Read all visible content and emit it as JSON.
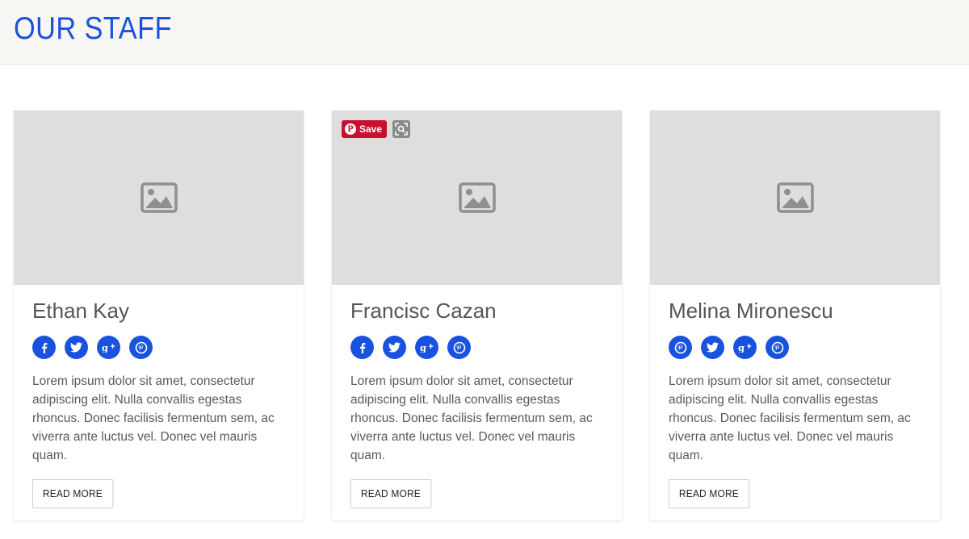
{
  "header": {
    "title": "OUR STAFF"
  },
  "pinterest": {
    "save_label": "Save"
  },
  "staff": [
    {
      "name": "Ethan Kay",
      "socials": [
        "facebook-icon",
        "twitter-icon",
        "google-plus-icon",
        "pinterest-icon"
      ],
      "bio": "Lorem ipsum dolor sit amet, consectetur adipiscing elit. Nulla convallis egestas rhoncus. Donec facilisis fermentum sem, ac viverra ante luctus vel. Donec vel mauris quam.",
      "button": "READ MORE"
    },
    {
      "name": "Francisc Cazan",
      "socials": [
        "facebook-icon",
        "twitter-icon",
        "google-plus-icon",
        "pinterest-icon"
      ],
      "bio": "Lorem ipsum dolor sit amet, consectetur adipiscing elit. Nulla convallis egestas rhoncus. Donec facilisis fermentum sem, ac viverra ante luctus vel. Donec vel mauris quam.",
      "button": "READ MORE"
    },
    {
      "name": "Melina Mironescu",
      "socials": [
        "pinterest-icon",
        "twitter-icon",
        "google-plus-icon",
        "pinterest-icon"
      ],
      "bio": "Lorem ipsum dolor sit amet, consectetur adipiscing elit. Nulla convallis egestas rhoncus. Donec facilisis fermentum sem, ac viverra ante luctus vel. Donec vel mauris quam.",
      "button": "READ MORE"
    }
  ],
  "colors": {
    "accent": "#1a52e0",
    "header_bg": "#f7f6f3",
    "image_placeholder": "#dedede",
    "pinterest_red": "#c8102e"
  }
}
